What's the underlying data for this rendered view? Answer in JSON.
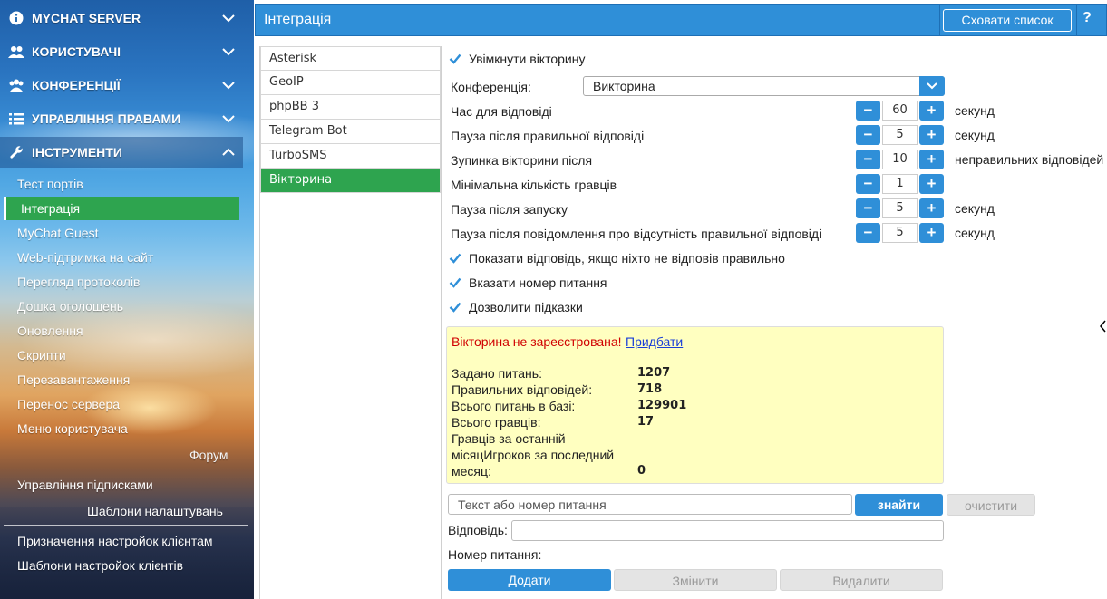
{
  "sidebar": {
    "sections": [
      {
        "label": "MYCHAT SERVER",
        "icon": "info-icon"
      },
      {
        "label": "КОРИСТУВАЧІ",
        "icon": "users-icon"
      },
      {
        "label": "КОНФЕРЕНЦІЇ",
        "icon": "conference-icon"
      },
      {
        "label": "УПРАВЛІННЯ ПРАВАМИ",
        "icon": "list-icon"
      },
      {
        "label": "ІНСТРУМЕНТИ",
        "icon": "wrench-icon"
      }
    ],
    "tools_items": [
      "Тест портів",
      "Інтеграція",
      "MyChat Guest",
      "Web-підтримка на сайт",
      "Перегляд протоколів",
      "Дошка оголошень",
      "Оновлення",
      "Скрипти",
      "Перезавантаження",
      "Перенос сервера",
      "Меню користувача"
    ],
    "forum_label": "Форум",
    "extra_items": [
      "Управління підписками",
      "Шаблони налаштувань",
      "Призначення настройок клієнтам",
      "Шаблони настройок клієнтів"
    ]
  },
  "header": {
    "title": "Інтеграція",
    "hide_button": "Сховати список",
    "help": "?"
  },
  "integrations": [
    "Asterisk",
    "GeoIP",
    "phpBB 3",
    "Telegram Bot",
    "TurboSMS",
    "Вікторина"
  ],
  "quiz": {
    "enable_label": "Увімкнути вікторину",
    "conference_label": "Конференція:",
    "conference_value": "Викторина",
    "params": [
      {
        "label": "Час для відповіді",
        "value": "60",
        "unit": "секунд"
      },
      {
        "label": "Пауза після правильної відповіді",
        "value": "5",
        "unit": "секунд"
      },
      {
        "label": "Зупинка вікторини після",
        "value": "10",
        "unit": "неправильних відповідей"
      },
      {
        "label": "Мінімальна кількість гравців",
        "value": "1",
        "unit": ""
      },
      {
        "label": "Пауза після запуску",
        "value": "5",
        "unit": "секунд"
      },
      {
        "label": "Пауза після повідомлення про відсутність правильної відповіді",
        "value": "5",
        "unit": "секунд"
      }
    ],
    "checkboxes": [
      "Показати відповідь, якщо ніхто не відповів правильно",
      "Вказати номер питання",
      "Дозволити підказки"
    ],
    "info": {
      "warning": "Вікторина не зареєстрована!",
      "link": "Придбати",
      "stats": [
        {
          "label": "Задано питань:",
          "value": "1207"
        },
        {
          "label": "Правильних відповідей:",
          "value": "718"
        },
        {
          "label": "Всього питань в базі:",
          "value": "129901"
        },
        {
          "label": "Всього гравців:",
          "value": "17"
        }
      ],
      "last_month_label_1": "Гравців за останній",
      "last_month_label_2": "місяцИгроков за последний",
      "last_month_label_3": "месяц:",
      "last_month_value": "0"
    },
    "search_placeholder": "Текст або номер питання",
    "find_button": "знайти",
    "clear_button": "очистити",
    "answer_label": "Відповідь:",
    "question_number_label": "Номер питання:",
    "add_button": "Додати",
    "edit_button": "Змінити",
    "delete_button": "Видалити"
  },
  "colors": {
    "accent": "#2f8fd8",
    "selected": "#2ea44f",
    "warning": "#d00000",
    "info_bg": "#ffffc0"
  }
}
